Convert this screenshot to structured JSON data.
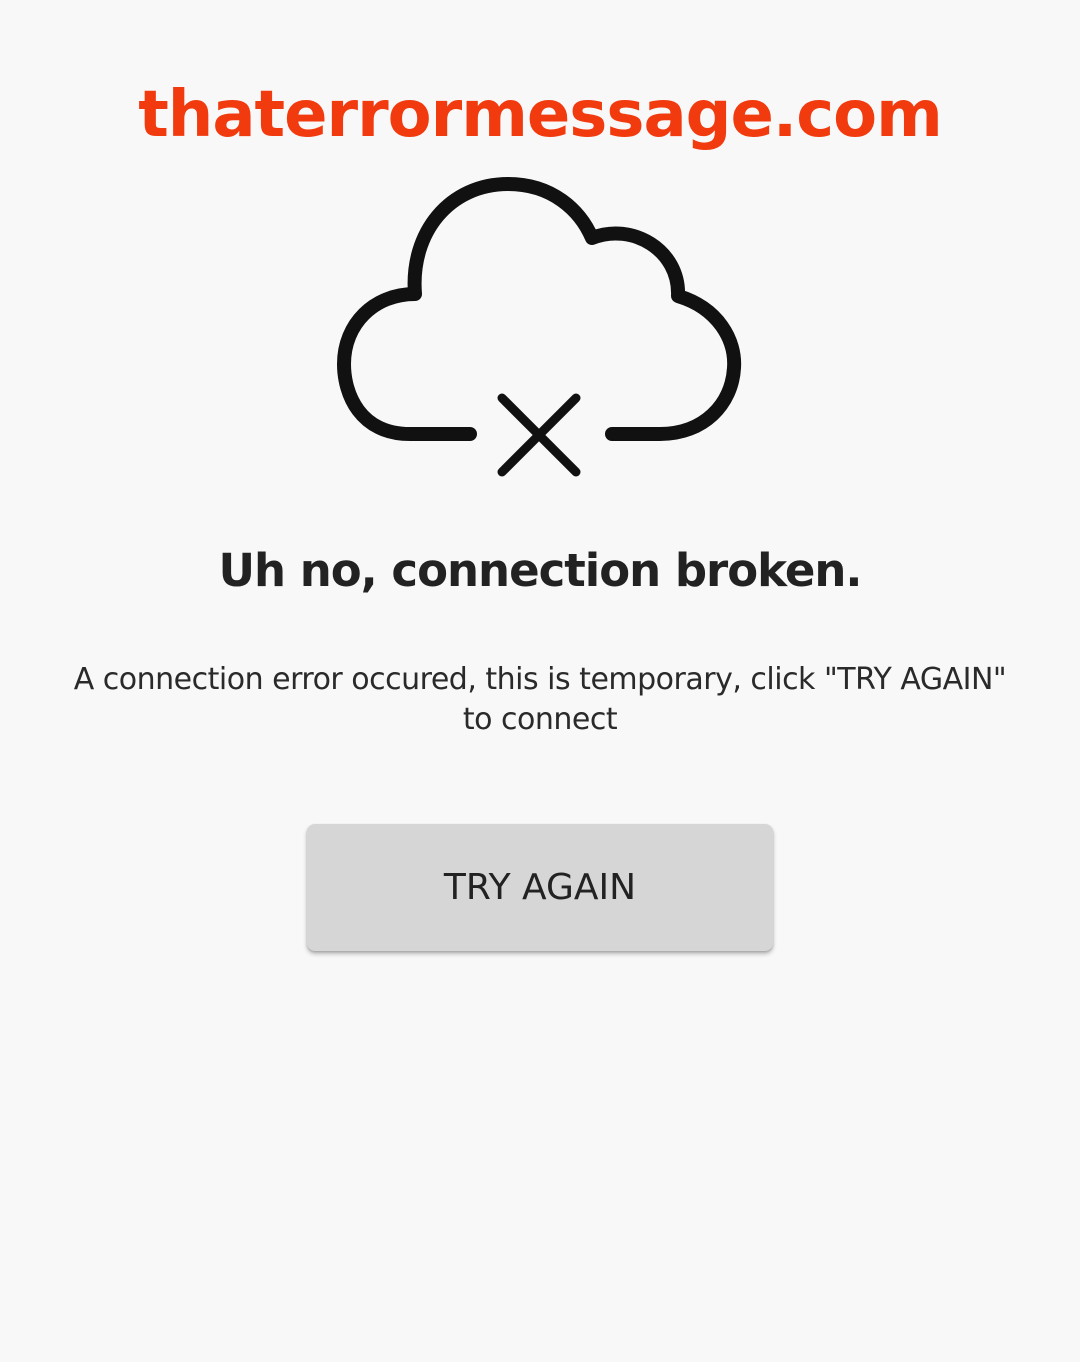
{
  "watermark": {
    "text": "thaterrormessage.com",
    "color": "#f23a0f"
  },
  "icon": {
    "name": "cloud-off-icon"
  },
  "error": {
    "title": "Uh no, connection broken.",
    "message": "A connection error occured, this is temporary, click \"TRY AGAIN\" to connect"
  },
  "actions": {
    "try_again_label": "TRY AGAIN"
  },
  "colors": {
    "background": "#f8f8f8",
    "button_background": "#d6d6d6",
    "text": "#222222"
  }
}
